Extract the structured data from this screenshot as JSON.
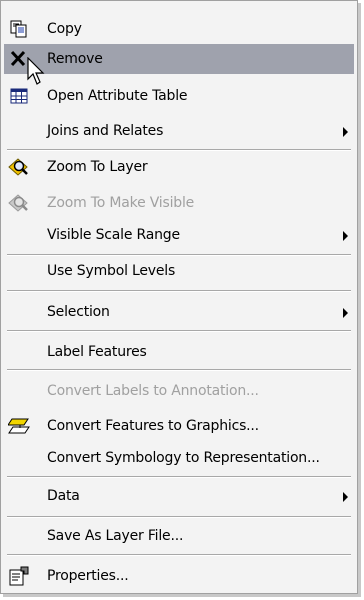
{
  "menu": {
    "items": [
      {
        "label": "Copy",
        "icon": "copy-icon"
      },
      {
        "label": "Remove",
        "icon": "remove-icon"
      },
      {
        "label": "Open Attribute Table",
        "icon": "attribute-table-icon"
      },
      {
        "label": "Joins and Relates",
        "submenu": true
      },
      {
        "label": "Zoom To Layer",
        "icon": "zoom-to-layer-icon"
      },
      {
        "label": "Zoom To Make Visible",
        "icon": "zoom-to-make-visible-icon",
        "disabled": true
      },
      {
        "label": "Visible Scale Range",
        "submenu": true
      },
      {
        "label": "Use Symbol Levels"
      },
      {
        "label": "Selection",
        "submenu": true
      },
      {
        "label": "Label Features"
      },
      {
        "label": "Convert Labels to Annotation...",
        "disabled": true
      },
      {
        "label": "Convert Features to Graphics...",
        "icon": "convert-features-icon"
      },
      {
        "label": "Convert Symbology to Representation..."
      },
      {
        "label": "Data",
        "submenu": true
      },
      {
        "label": "Save As Layer File..."
      },
      {
        "label": "Properties...",
        "icon": "properties-icon"
      }
    ]
  },
  "colors": {
    "highlight": "#9fa2ad",
    "menu_bg": "#f3f3f3",
    "disabled_text": "#a0a0a0"
  }
}
